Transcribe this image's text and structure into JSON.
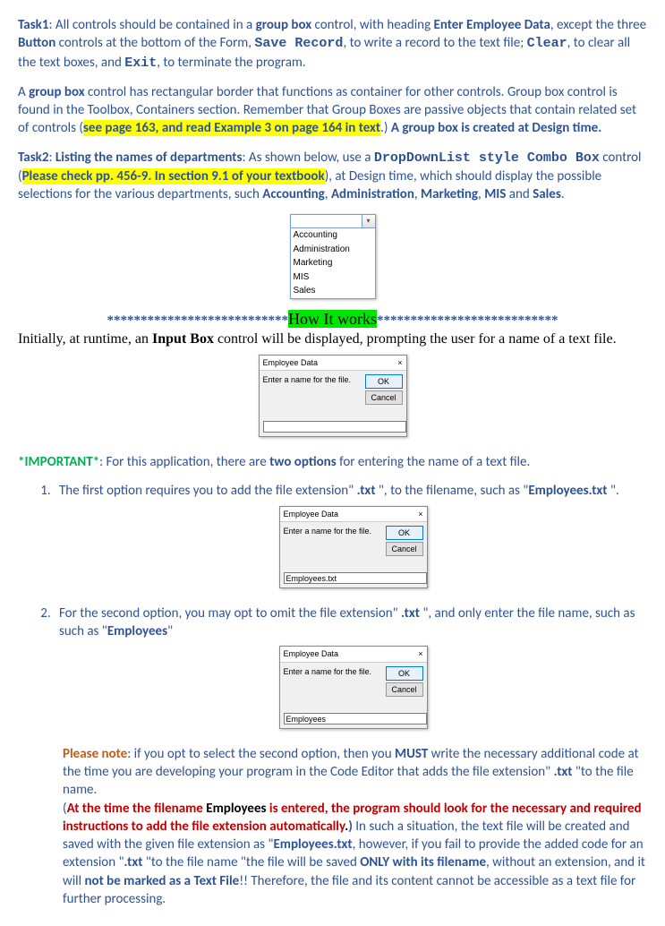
{
  "p1": {
    "t1": "Task1",
    "a": ": All controls should be contained in a ",
    "gb": "group box",
    "b": " control, with heading ",
    "eed": "Enter Employee Data",
    "c": ", except the three ",
    "btn": "Button",
    "d": " controls at the bottom of the Form, ",
    "sr": "Save Record",
    "e": ", to write a record to the text file; ",
    "cl": "Clear",
    "f": ", to clear all the text boxes, and ",
    "ex": "Exit",
    "g": ",  to terminate the program."
  },
  "p2": {
    "a": "A ",
    "gb": "group box",
    "b": " control has rectangular border that functions as container for other controls. Group box control is found in the Toolbox, Containers section. Remember that Group Boxes are passive objects that contain related set of controls (",
    "hl": "see page 163, and read Example 3 on page 164 in text",
    "c": ".) ",
    "d": "A group box is created at Design time."
  },
  "p3": {
    "t2": "Task2",
    "a": ": ",
    "ln": "Listing the names of departments",
    "b": ": As shown below, use a ",
    "ddl": "DropDownList style Combo Box",
    "c": " control (",
    "hl": "Please check pp. 456-9. In section 9.1 of your textbook",
    "d": "), at Design time, which should display the possible selections for the various departments, such ",
    "acc": "Accounting",
    "e": ", ",
    "adm": "Administration",
    "f": ", ",
    "mkt": "Marketing",
    "g": ", ",
    "mis": "MIS",
    "h": " and ",
    "sal": "Sales",
    "i": "."
  },
  "combo": [
    "Accounting",
    "Administration",
    "Marketing",
    "MIS",
    "Sales"
  ],
  "divider": {
    "stars": "***************************",
    "title": "How It works"
  },
  "p4": "Initially, at runtime, an ",
  "p4b": "Input Box",
  "p4c": " control will be displayed, prompting the user for a name of a text file.",
  "dlg": {
    "title": "Employee Data",
    "x": "×",
    "prompt": "Enter a name for the file.",
    "ok": "OK",
    "cancel": "Cancel",
    "v1": "",
    "v2": "Employees.txt",
    "v3": "Employees"
  },
  "imp": {
    "a": "*IMPORTANT*",
    "b": ": For this application, there are ",
    "c": "two options",
    "d": " for entering the name of a text file."
  },
  "li1": {
    "a": "The first option requires you to add the file extension\" ",
    "txt": ".txt",
    "b": " \", to the filename, such as \"",
    "emp": "Employees.txt",
    "c": " \"."
  },
  "li2": {
    "a": "For the second option, you may opt to omit the file extension\" ",
    "txt": ".txt",
    "b": " \", and only enter the file name, such as such as \"",
    "emp": "Employees",
    "c": "\""
  },
  "note": {
    "pn": "Please note",
    "a": ":  if you opt to select the second option, then you ",
    "must": "MUST",
    "b": " write the necessary additional code at the time you are developing your program in the Code Editor that adds the file extension\" ",
    "txt": ".txt",
    "c": " \"to the file name.",
    "d": "(",
    "red1": "At the time the filename ",
    "red2": "Employees",
    "red3": " is entered, the program should look for the necessary and required instructions to add the file extension automatically",
    "red4": ".",
    "e": ") ",
    "f": "In such a situation, the text file will be created and saved with the given file extension as \"",
    "empT": "Employees.txt",
    "g": ", however, if you fail to provide the added code for an extension \"",
    "txt2": ".txt",
    "h": " \"to the file name \"the file will be saved ",
    "only": "ONLY with its filename",
    "i": ", without an extension, and it will ",
    "nm": "not be marked as a Text File",
    "j": "!! Therefore, the file and its content cannot be accessible as a text file for further processing."
  }
}
